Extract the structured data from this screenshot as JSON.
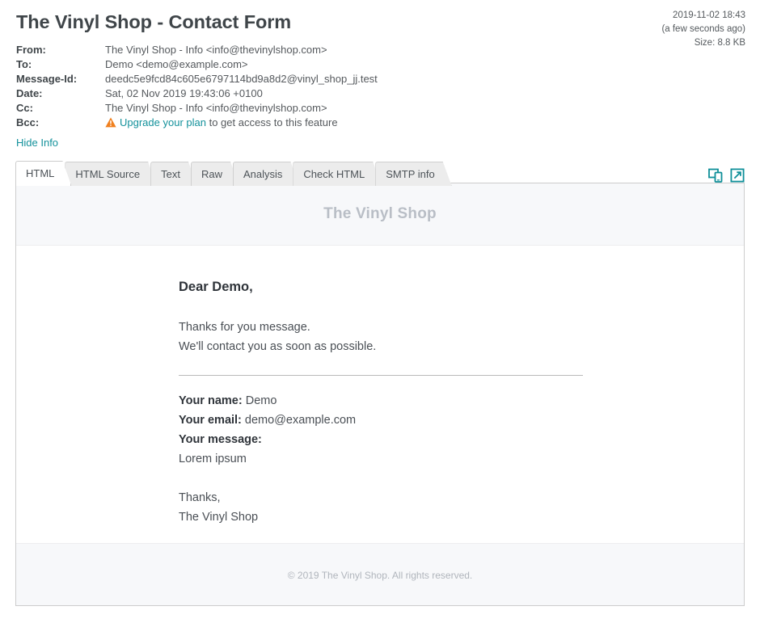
{
  "header": {
    "title": "The Vinyl Shop - Contact Form",
    "received_at": "2019-11-02 18:43",
    "relative_time": "(a few seconds ago)",
    "size": "Size: 8.8 KB"
  },
  "info": {
    "rows": [
      {
        "label": "From:",
        "value": "The Vinyl Shop - Info <info@thevinylshop.com>"
      },
      {
        "label": "To:",
        "value": "Demo <demo@example.com>"
      },
      {
        "label": "Message-Id:",
        "value": "deedc5e9fcd84c605e6797114bd9a8d2@vinyl_shop_jj.test"
      },
      {
        "label": "Date:",
        "value": "Sat, 02 Nov 2019 19:43:06 +0100"
      },
      {
        "label": "Cc:",
        "value": "The Vinyl Shop - Info <info@thevinylshop.com>"
      }
    ],
    "bcc_label": "Bcc:",
    "bcc_link": "Upgrade your plan",
    "bcc_suffix": " to get access to this feature",
    "toggle_info": "Hide Info"
  },
  "tabs": [
    {
      "label": "HTML",
      "active": true
    },
    {
      "label": "HTML Source",
      "active": false
    },
    {
      "label": "Text",
      "active": false
    },
    {
      "label": "Raw",
      "active": false
    },
    {
      "label": "Analysis",
      "active": false
    },
    {
      "label": "Check HTML",
      "active": false
    },
    {
      "label": "SMTP info",
      "active": false
    }
  ],
  "tab_actions": {
    "responsive_icon": "responsive-preview-icon",
    "open_new_window_icon": "open-in-new-window-icon"
  },
  "email": {
    "brand": "The Vinyl Shop",
    "greeting": "Dear Demo,",
    "paragraph_1": "Thanks for you message.",
    "paragraph_2": "We'll contact you as soon as possible.",
    "name_label": "Your name:",
    "name_value": " Demo",
    "email_label": "Your email:",
    "email_value": " demo@example.com",
    "message_label": "Your message:",
    "message_value": "Lorem ipsum",
    "signoff_1": "Thanks,",
    "signoff_2": "The Vinyl Shop",
    "footer": "© 2019 The Vinyl Shop. All rights reserved."
  },
  "colors": {
    "accent_teal": "#13919b",
    "warning_orange": "#f0801f",
    "title_gray": "#3f4549",
    "panel_border": "#cccccc"
  }
}
